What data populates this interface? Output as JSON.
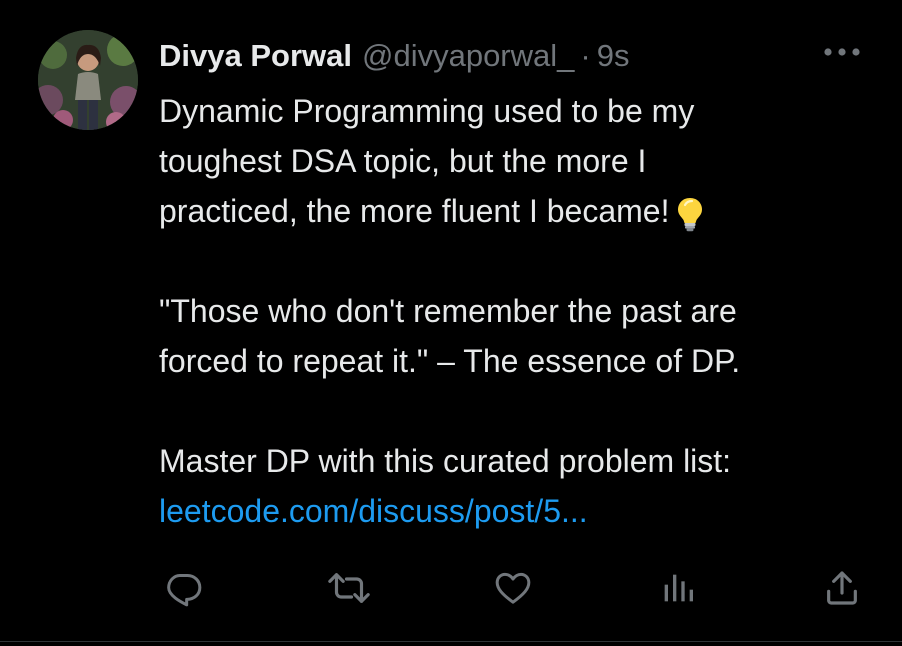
{
  "tweet": {
    "author_name": "Divya Porwal",
    "handle": "@divyaporwal_",
    "separator": "·",
    "timestamp": "9s",
    "lines": {
      "l1": "Dynamic Programming used to be my",
      "l2": "toughest DSA topic, but the more I",
      "l3": "practiced, the more fluent I became!",
      "l4": "\"Those who don't remember the past are",
      "l5": "forced to repeat it.\" – The essence of DP.",
      "l6": "Master DP with this curated problem list:"
    },
    "link_text": "leetcode.com/discuss/post/5...",
    "emoji": "light-bulb"
  },
  "actions": {
    "reply_icon": "reply-icon",
    "retweet_icon": "retweet-icon",
    "like_icon": "heart-icon",
    "views_icon": "analytics-icon",
    "share_icon": "share-icon"
  },
  "colors": {
    "background": "#000000",
    "text": "#e7e9ea",
    "muted": "#71767b",
    "link": "#1d9bf0"
  }
}
